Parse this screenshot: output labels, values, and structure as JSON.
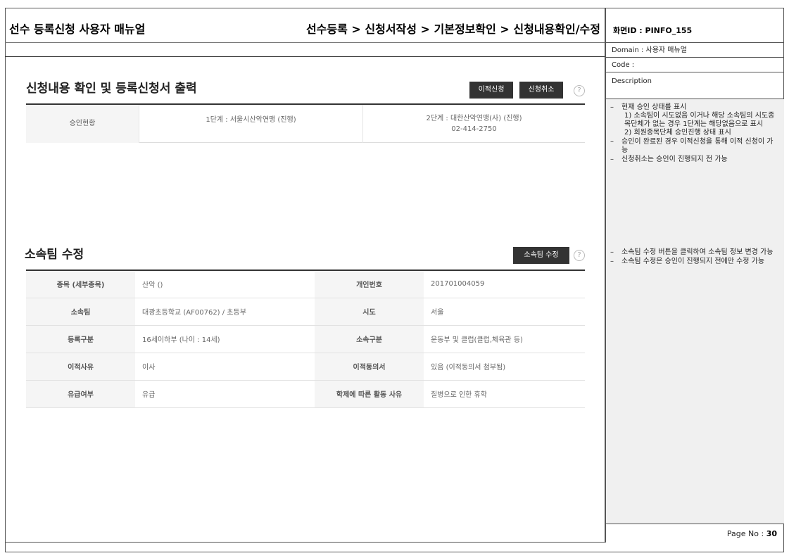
{
  "header": {
    "manual_title": "선수 등록신청 사용자 매뉴얼",
    "breadcrumb": "선수등록 > 신청서작성 > 기본정보확인 > 신청내용확인/수정"
  },
  "section_confirm": {
    "title": "신청내용 확인 및 등록신청서 출력",
    "transfer_button": "이적신청",
    "cancel_button": "신청취소",
    "help_icon": "?",
    "approval": {
      "label": "승인현황",
      "step1": "1단계 : 서울시산악연맹 (진행)",
      "step2": "2단계 : 대한산악연맹(사) (진행)",
      "step2_phone": "02-414-2750"
    }
  },
  "section_team": {
    "title": "소속팀 수정",
    "edit_button": "소속팀 수정",
    "help_icon": "?",
    "rows": [
      {
        "k1": "종목 (세부종목)",
        "v1": "산악 ()",
        "k2": "개인번호",
        "v2": "201701004059"
      },
      {
        "k1": "소속팀",
        "v1": "대광초등학교 (AF00762) / 초등부",
        "k2": "시도",
        "v2": "서울"
      },
      {
        "k1": "등록구분",
        "v1": "16세이하부 (나이 : 14세)",
        "k2": "소속구분",
        "v2": "운동부 및 클럽(클럽,체육관 등)"
      },
      {
        "k1": "이적사유",
        "v1": "이사",
        "k2": "이적동의서",
        "v2": "있음 (이적동의서 첨부됨)"
      },
      {
        "k1": "유급여부",
        "v1": "유급",
        "k2": "학제에 따른 활동 사유",
        "v2": "질병으로 인한 휴학"
      }
    ]
  },
  "side": {
    "screen_id": "화면ID : PINFO_155",
    "domain": "Domain : 사용자 매뉴얼",
    "code": "Code :",
    "description_label": "Description",
    "desc1": {
      "item1": "현재 승인 상태를 표시",
      "item1_sub1": "1) 소속팀이 시도없음 이거나 해당 소속팀의 시도종목단체가 없는 경우 1단계는 해당없음으로 표시",
      "item1_sub2": "2) 회원종목단체 승인진행 상태 표시",
      "item2": "승인이 완료된 경우 이적신청을 통해 이적 신청이 가능",
      "item3": "신청취소는 승인이 진행되지 전 가능"
    },
    "desc2": {
      "item1": "소속팀 수정 버튼을 클릭하여 소속팀 정보 변경 가능",
      "item2": "소속팀 수정은 승인이 진행되지 전에만 수정 가능"
    },
    "page_label": "Page No : ",
    "page_number": "30"
  }
}
